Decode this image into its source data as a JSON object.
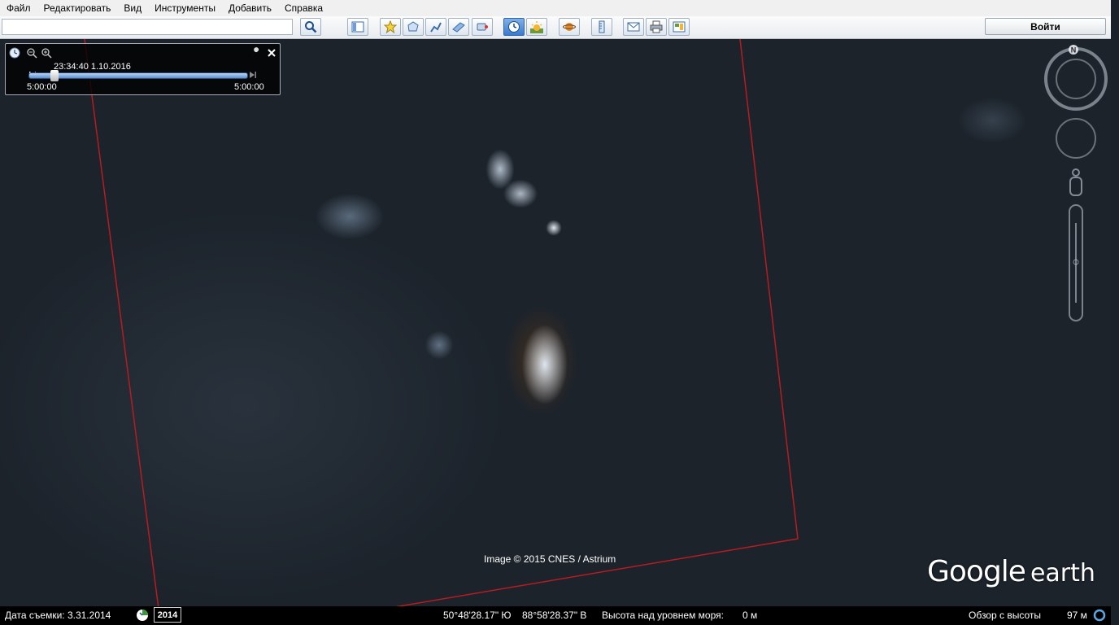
{
  "menu": {
    "items": [
      "Файл",
      "Редактировать",
      "Вид",
      "Инструменты",
      "Добавить",
      "Справка"
    ]
  },
  "toolbar": {
    "search_value": "",
    "signin_label": "Войти",
    "icons": [
      "search-icon",
      "sidebar-toggle-icon",
      "add-placemark-icon",
      "add-polygon-icon",
      "add-path-icon",
      "add-image-overlay-icon",
      "record-tour-icon",
      "historical-imagery-icon",
      "sunlight-icon",
      "planets-icon",
      "ruler-icon",
      "email-icon",
      "print-icon",
      "save-image-icon"
    ]
  },
  "time_slider": {
    "current": "23:34:40 1.10.2016",
    "start": "5:00:00",
    "end": "5:00:00",
    "position": 0.06
  },
  "map": {
    "copyright": "Image © 2015 CNES / Astrium",
    "logo_google": "Google",
    "logo_earth": "earth",
    "boundary_color": "#b81c22"
  },
  "statusbar": {
    "date_label": "Дата съемки: 3.31.2014",
    "year": "2014",
    "latitude": "50°48'28.17\" Ю",
    "longitude": "88°58'28.37\" В",
    "elevation_label": "Высота над уровнем моря:",
    "elevation_value": "0 м",
    "eye_alt_label": "Обзор с высоты",
    "eye_alt_value": "97 м"
  },
  "colors": {
    "accent": "#3a7bd0",
    "status_bg": "#000000"
  }
}
